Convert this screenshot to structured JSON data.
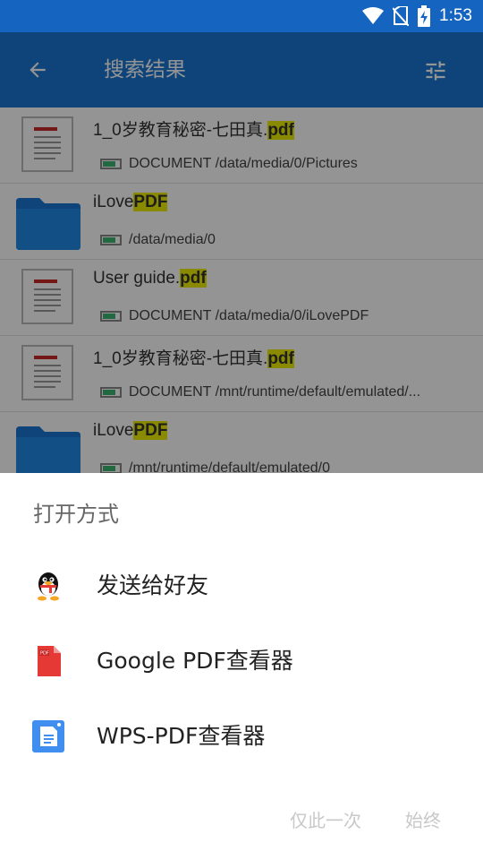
{
  "status": {
    "time": "1:53"
  },
  "appbar": {
    "title": "搜索结果"
  },
  "results": [
    {
      "type": "doc",
      "name_pre": "1_0岁教育秘密-七田真.",
      "name_hl": "pdf",
      "meta": "DOCUMENT /data/media/0/Pictures"
    },
    {
      "type": "folder",
      "name_pre": "iLove",
      "name_hl": "PDF",
      "meta": "/data/media/0"
    },
    {
      "type": "doc",
      "name_pre": "User guide.",
      "name_hl": "pdf",
      "meta": "DOCUMENT /data/media/0/iLovePDF"
    },
    {
      "type": "doc",
      "name_pre": "1_0岁教育秘密-七田真.",
      "name_hl": "pdf",
      "meta": "DOCUMENT /mnt/runtime/default/emulated/..."
    },
    {
      "type": "folder",
      "name_pre": "iLove",
      "name_hl": "PDF",
      "meta": "/mnt/runtime/default/emulated/0"
    }
  ],
  "sheet": {
    "title": "打开方式",
    "options": [
      {
        "label": "发送给好友",
        "icon": "qq-icon"
      },
      {
        "label": "Google PDF查看器",
        "icon": "google-pdf-icon"
      },
      {
        "label": "WPS-PDF查看器",
        "icon": "wps-pdf-icon"
      }
    ],
    "just_once": "仅此一次",
    "always": "始终"
  },
  "colors": {
    "appbar": "#1976d2",
    "statusbar": "#1565c0",
    "highlight": "#eeee00"
  }
}
